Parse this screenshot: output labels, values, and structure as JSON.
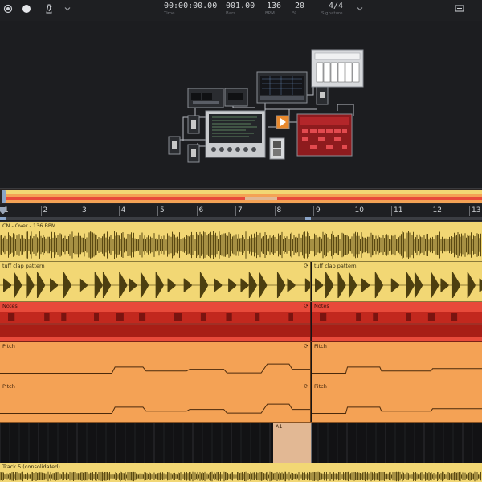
{
  "transport": {
    "time": {
      "value": "00:00:00.00",
      "label": "Time"
    },
    "bars": {
      "value": "001.00",
      "label": "Bars"
    },
    "bpm": {
      "value": "136",
      "label": "BPM"
    },
    "swing": {
      "value": "20",
      "label": "%"
    },
    "signature": {
      "value": "4/4",
      "label": "Signature"
    }
  },
  "icons": {
    "record": "record-icon",
    "metronome": "metronome-icon",
    "menu": "chevron-down-icon",
    "screen": "screen-icon"
  },
  "ruler": {
    "bars": [
      "1",
      "2",
      "3",
      "4",
      "5",
      "6",
      "7",
      "8",
      "9",
      "10",
      "11",
      "12",
      "13"
    ]
  },
  "tracks": [
    {
      "title": "CN - Over - 136 BPM",
      "color": "#f2d774"
    },
    {
      "title": "tuff clap pattern",
      "title_right": "tuff clap pattern",
      "color": "#f2d774"
    },
    {
      "title": "Notes",
      "title_right": "Notes",
      "color": "#e84a3a"
    },
    {
      "title": "Pitch",
      "title_right": "Pitch",
      "color": "#f4a255"
    },
    {
      "title": "Pitch",
      "title_right": "Pitch",
      "color": "#f4a255"
    },
    {
      "title": "A1",
      "color": "#e2b894"
    },
    {
      "title": "Track 5 (consolidated)",
      "color": "#f2d774"
    }
  ],
  "colors": {
    "accent_orange": "#f4a255",
    "accent_yellow": "#f2d774",
    "accent_red": "#e84a3a",
    "background": "#1c1d20"
  }
}
